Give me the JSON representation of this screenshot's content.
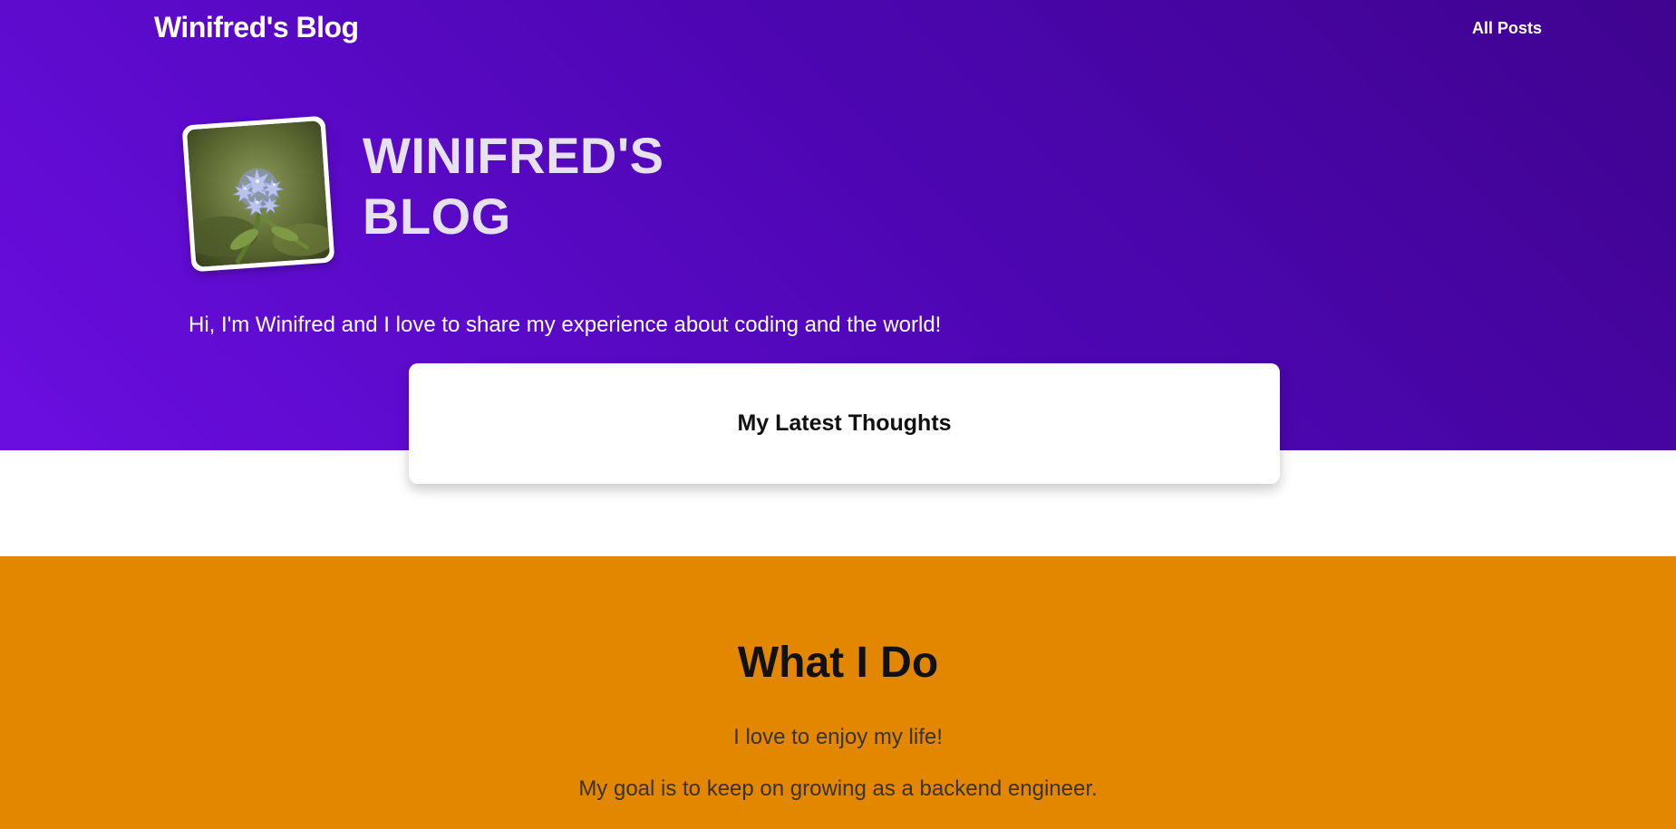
{
  "nav": {
    "brand": "Winifred's Blog",
    "links": [
      {
        "label": "All Posts"
      }
    ]
  },
  "hero": {
    "title_line1": "WINIFRED'S",
    "title_line2": "BLOG",
    "tagline": "Hi, I'm Winifred and I love to share my experience about coding and the world!",
    "avatar": "avatar-flower-image"
  },
  "card": {
    "title": "My Latest Thoughts"
  },
  "what_i_do": {
    "title": "What I Do",
    "lines": [
      "I love to enjoy my life!",
      "My goal is to keep on growing as a backend engineer."
    ]
  },
  "colors": {
    "hero_gradient_start": "#3f048f",
    "hero_gradient_end": "#6a0ee0",
    "section_orange": "#e48700",
    "card_bg": "#ffffff"
  }
}
